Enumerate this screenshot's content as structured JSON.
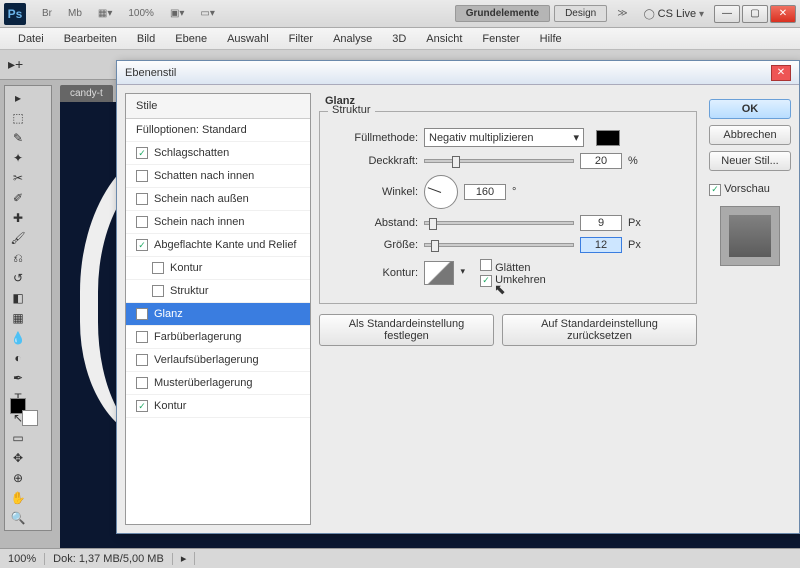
{
  "titlebar": {
    "br": "Br",
    "mb": "Mb",
    "zoom": "100%",
    "g1": "Grundelemente",
    "g2": "Design",
    "cs": "CS Live"
  },
  "menus": [
    "Datei",
    "Bearbeiten",
    "Bild",
    "Ebene",
    "Auswahl",
    "Filter",
    "Analyse",
    "3D",
    "Ansicht",
    "Fenster",
    "Hilfe"
  ],
  "doc_tab": "candy-t",
  "status": {
    "zoom": "100%",
    "doc": "Dok: 1,37 MB/5,00 MB"
  },
  "dialog": {
    "title": "Ebenenstil",
    "styles_header": "Stile",
    "fill_opts": "Fülloptionen: Standard",
    "items": [
      {
        "label": "Schlagschatten",
        "checked": true
      },
      {
        "label": "Schatten nach innen",
        "checked": false
      },
      {
        "label": "Schein nach außen",
        "checked": false
      },
      {
        "label": "Schein nach innen",
        "checked": false
      },
      {
        "label": "Abgeflachte Kante und Relief",
        "checked": true
      },
      {
        "label": "Kontur",
        "checked": false,
        "sub": true
      },
      {
        "label": "Struktur",
        "checked": false,
        "sub": true
      },
      {
        "label": "Glanz",
        "checked": true,
        "sel": true
      },
      {
        "label": "Farbüberlagerung",
        "checked": false
      },
      {
        "label": "Verlaufsüberlagerung",
        "checked": false
      },
      {
        "label": "Musterüberlagerung",
        "checked": false
      },
      {
        "label": "Kontur",
        "checked": true
      }
    ],
    "panel_title": "Glanz",
    "struct_title": "Struktur",
    "labels": {
      "fill": "Füllmethode:",
      "opacity": "Deckkraft:",
      "angle": "Winkel:",
      "dist": "Abstand:",
      "size": "Größe:",
      "kontur": "Kontur:"
    },
    "fill_method": "Negativ multiplizieren",
    "opacity": "20",
    "opacity_unit": "%",
    "angle": "160",
    "angle_unit": "°",
    "dist": "9",
    "dist_unit": "Px",
    "size": "12",
    "size_unit": "Px",
    "glatten": "Glätten",
    "umkehren": "Umkehren",
    "btn_default": "Als Standardeinstellung festlegen",
    "btn_reset": "Auf Standardeinstellung zurücksetzen",
    "ok": "OK",
    "cancel": "Abbrechen",
    "newstyle": "Neuer Stil...",
    "preview": "Vorschau"
  }
}
